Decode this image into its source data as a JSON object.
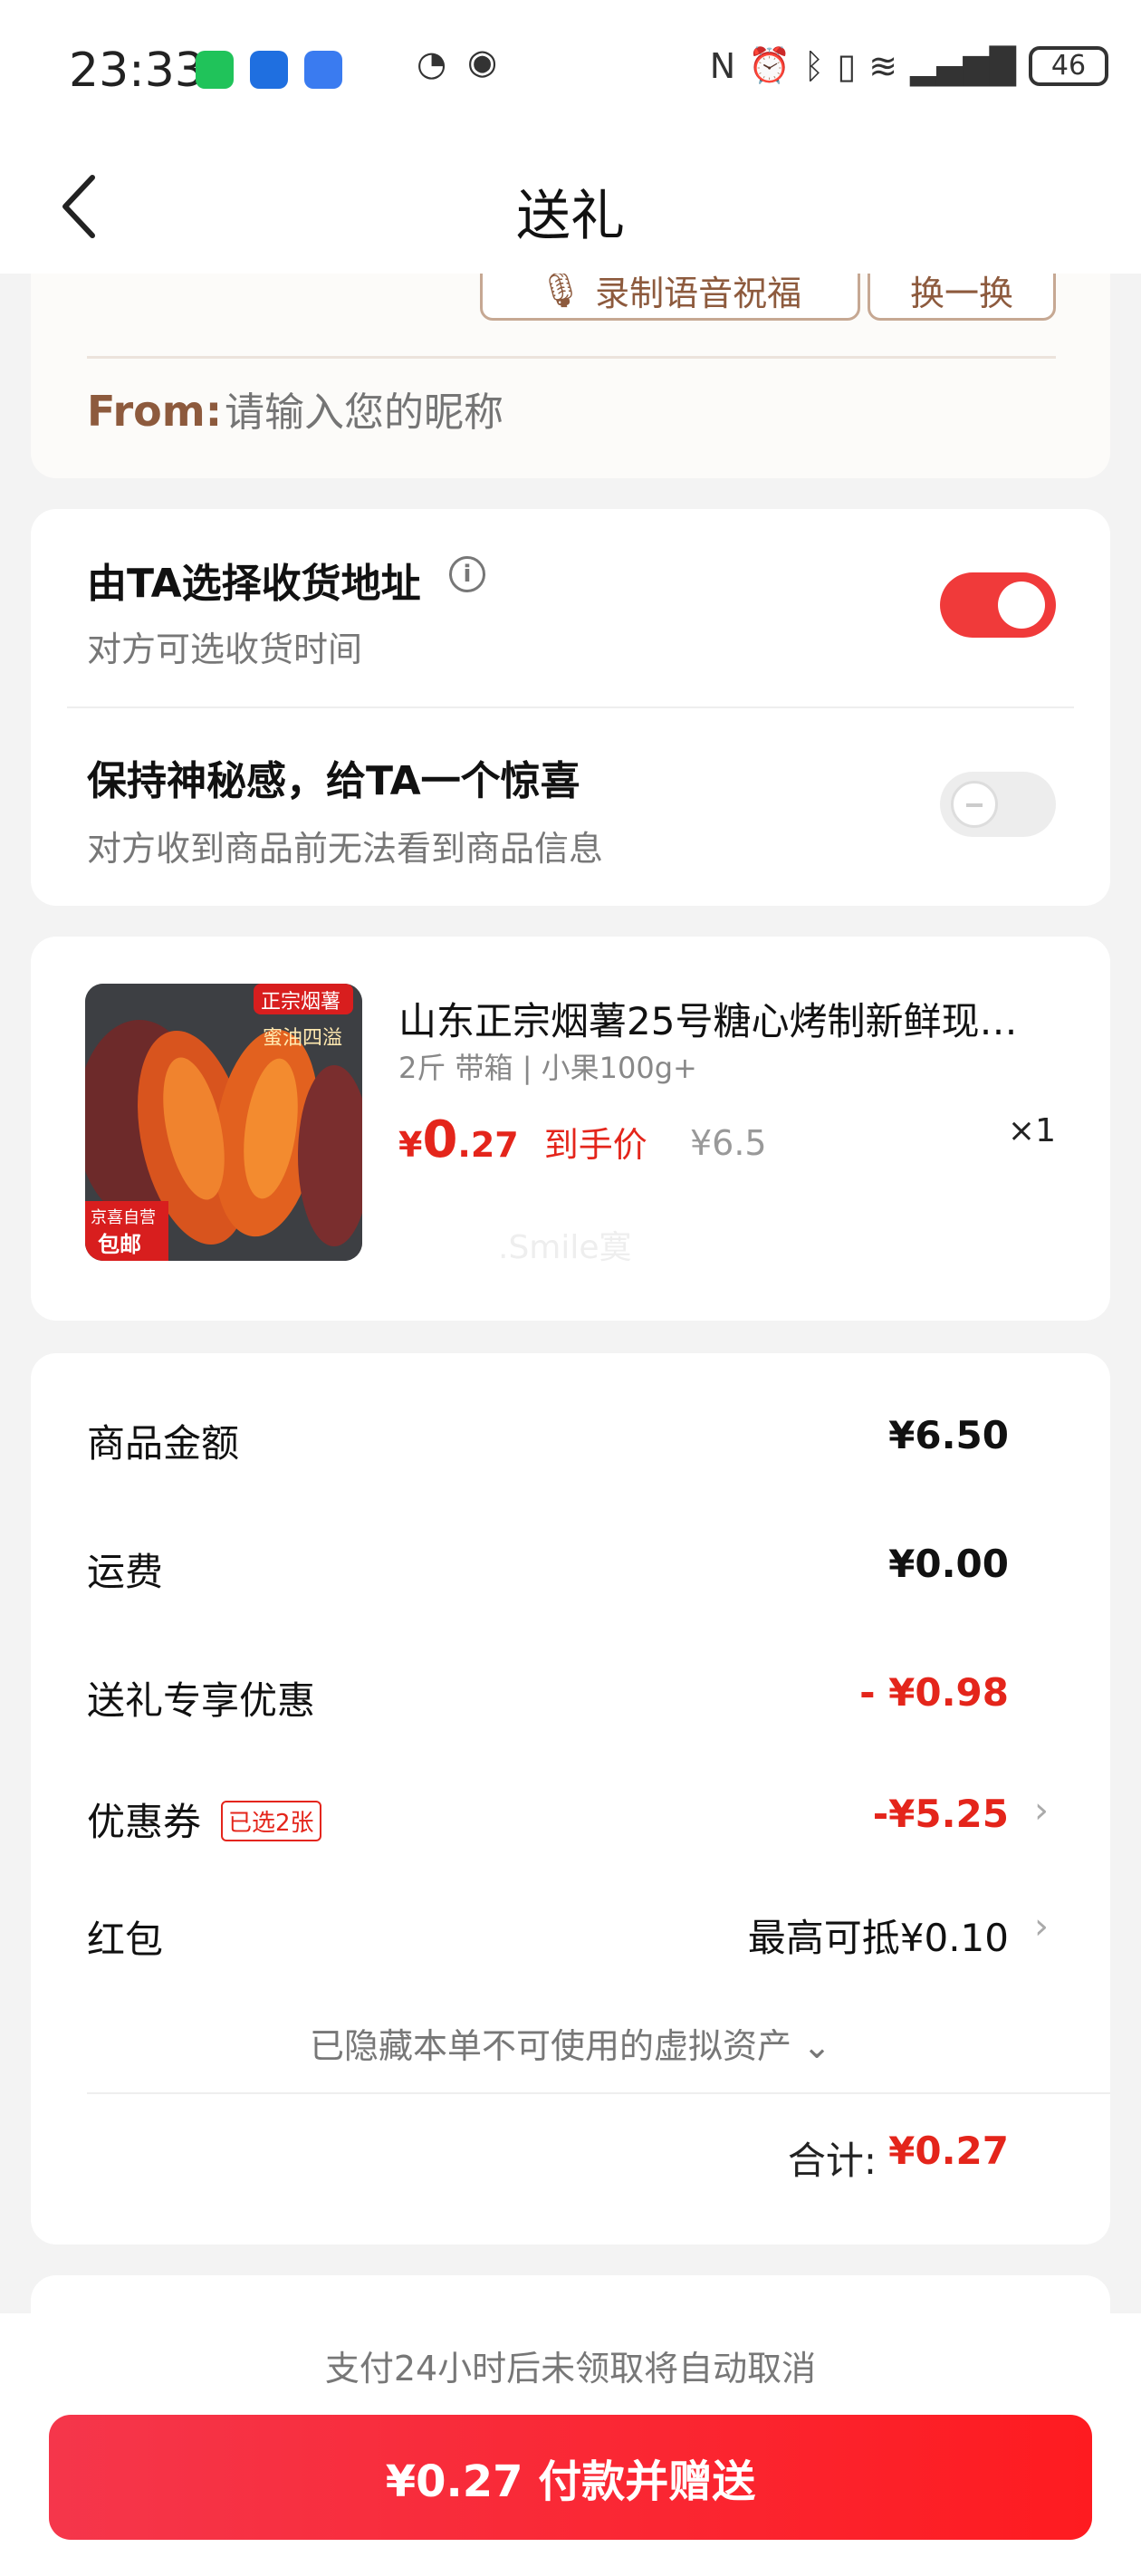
{
  "status_bar": {
    "time": "23:33",
    "battery": "46"
  },
  "nav": {
    "title": "送礼"
  },
  "message_card": {
    "voice_button": "录制语音祝福",
    "swap_button": "换一换",
    "from_label": "From:",
    "from_placeholder": "请输入您的昵称"
  },
  "options": {
    "recipient_address": {
      "title": "由TA选择收货地址",
      "subtitle": "对方可选收货时间",
      "enabled": true
    },
    "mystery": {
      "title": "保持神秘感，给TA一个惊喜",
      "subtitle": "对方收到商品前无法看到商品信息",
      "enabled": false
    }
  },
  "product": {
    "name": "山东正宗烟薯25号糖心烤制新鲜现…",
    "spec": "2斤 带箱 | 小果100g+",
    "price_currency": "¥",
    "price_integer": "0",
    "price_decimal": ".27",
    "price_label": "到手价",
    "original_price": "¥6.5",
    "quantity": "×1",
    "image_badge_top": "正宗烟薯",
    "image_caption": "蜜油四溢",
    "image_badge_bottom_1": "京喜自营",
    "image_badge_bottom_2": "包邮",
    "watermark": ".Smile寞"
  },
  "summary": {
    "items": [
      {
        "label": "商品金额",
        "value": "¥6.50"
      },
      {
        "label": "运费",
        "value": "¥0.00"
      },
      {
        "label": "送礼专享优惠",
        "value": "- ¥0.98"
      },
      {
        "label": "优惠券",
        "value": "-¥5.25",
        "badge": "已选2张"
      },
      {
        "label": "红包",
        "value": "最高可抵¥0.10"
      }
    ],
    "hidden_note": "已隐藏本单不可使用的虚拟资产 ⌄",
    "total_label": "合计:",
    "total_value": "¥0.27"
  },
  "bottom": {
    "cancel_note": "支付24小时后未领取将自动取消",
    "pay_button": "¥0.27 付款并赠送"
  },
  "colors": {
    "accent": "#e4251b",
    "brown": "#8d5a3d",
    "toggle_on": "#f03a3a"
  }
}
